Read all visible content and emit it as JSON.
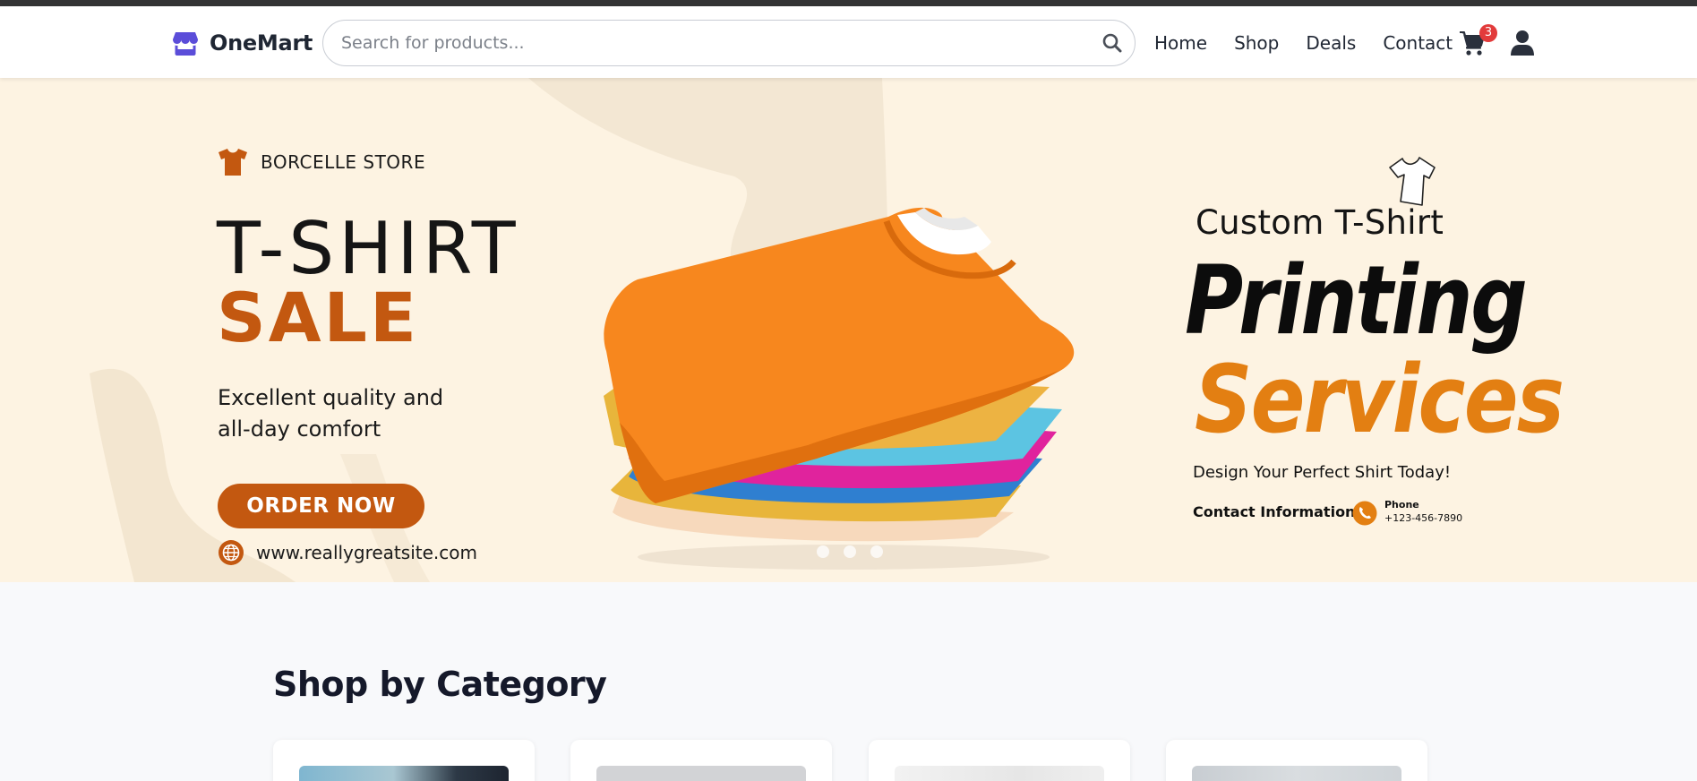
{
  "header": {
    "brand_name": "OneMart",
    "search_placeholder": "Search for products...",
    "nav": [
      "Home",
      "Shop",
      "Deals",
      "Contact"
    ],
    "cart_count": "3",
    "colors": {
      "brand_accent": "#5b4dd9",
      "badge": "#e23b3b"
    }
  },
  "hero": {
    "store_name": "BORCELLE STORE",
    "title": "T-SHIRT",
    "title_accent": "SALE",
    "tagline_line1": "Excellent quality and",
    "tagline_line2": "all-day comfort",
    "cta": "ORDER NOW",
    "website": "www.reallygreatsite.com",
    "right_subtitle": "Custom T-Shirt",
    "right_title": "Printing",
    "right_title_accent": "Services",
    "right_tagline": "Design Your Perfect Shirt Today!",
    "contact_label": "Contact Information",
    "phone_label": "Phone",
    "phone_number": "+123-456-7890",
    "slides": 3,
    "colors": {
      "background": "#fdf3e2",
      "accent": "#c35810",
      "accent_bright": "#e37f12"
    }
  },
  "categories": {
    "title": "Shop by Category"
  }
}
